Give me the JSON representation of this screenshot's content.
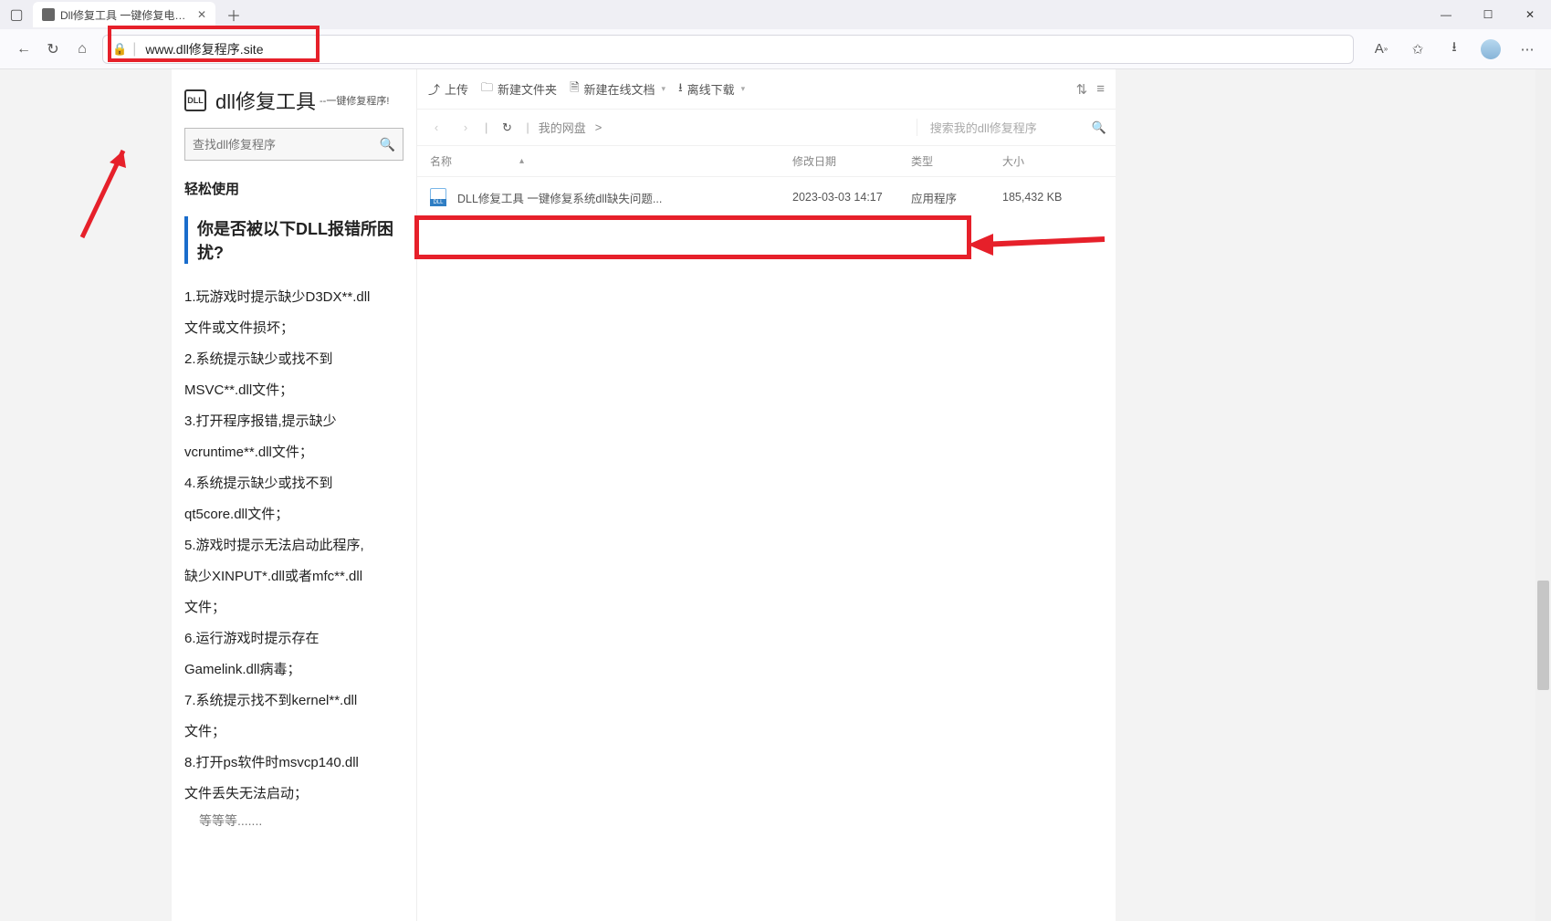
{
  "tab": {
    "title": "Dll修复工具 一键修复电脑丢失Dll"
  },
  "url": "www.dll修复程序.site",
  "brand": {
    "title": "dll修复工具",
    "subtitle": "--一键修复程序!"
  },
  "search": {
    "placeholder": "查找dll修复程序"
  },
  "section": "轻松使用",
  "question": "你是否被以下DLL报错所困扰?",
  "paras": [
    "1.玩游戏时提示缺少D3DX**.dll",
    "文件或文件损坏；",
    "2.系统提示缺少或找不到",
    "MSVC**.dll文件；",
    "3.打开程序报错,提示缺少",
    "vcruntime**.dll文件；",
    "4.系统提示缺少或找不到",
    "qt5core.dll文件；",
    "5.游戏时提示无法启动此程序,",
    "缺少XINPUT*.dll或者mfc**.dll",
    "文件；",
    "6.运行游戏时提示存在",
    "Gamelink.dll病毒；",
    "7.系统提示找不到kernel**.dll",
    "文件；",
    "8.打开ps软件时msvcp140.dll",
    "文件丢失无法启动；"
  ],
  "ellipsis": "等等等.......",
  "toolbar": {
    "upload": "上传",
    "newfolder": "新建文件夹",
    "newonline": "新建在线文档",
    "offline": "离线下载"
  },
  "breadcrumb": {
    "root": "我的网盘",
    "sep": ">"
  },
  "panelSearch": "搜索我的dll修复程序",
  "columns": {
    "name": "名称",
    "date": "修改日期",
    "type": "类型",
    "size": "大小"
  },
  "file": {
    "name": "DLL修复工具  一键修复系统dll缺失问题...",
    "date": "2023-03-03 14:17",
    "type": "应用程序",
    "size": "185,432 KB"
  }
}
